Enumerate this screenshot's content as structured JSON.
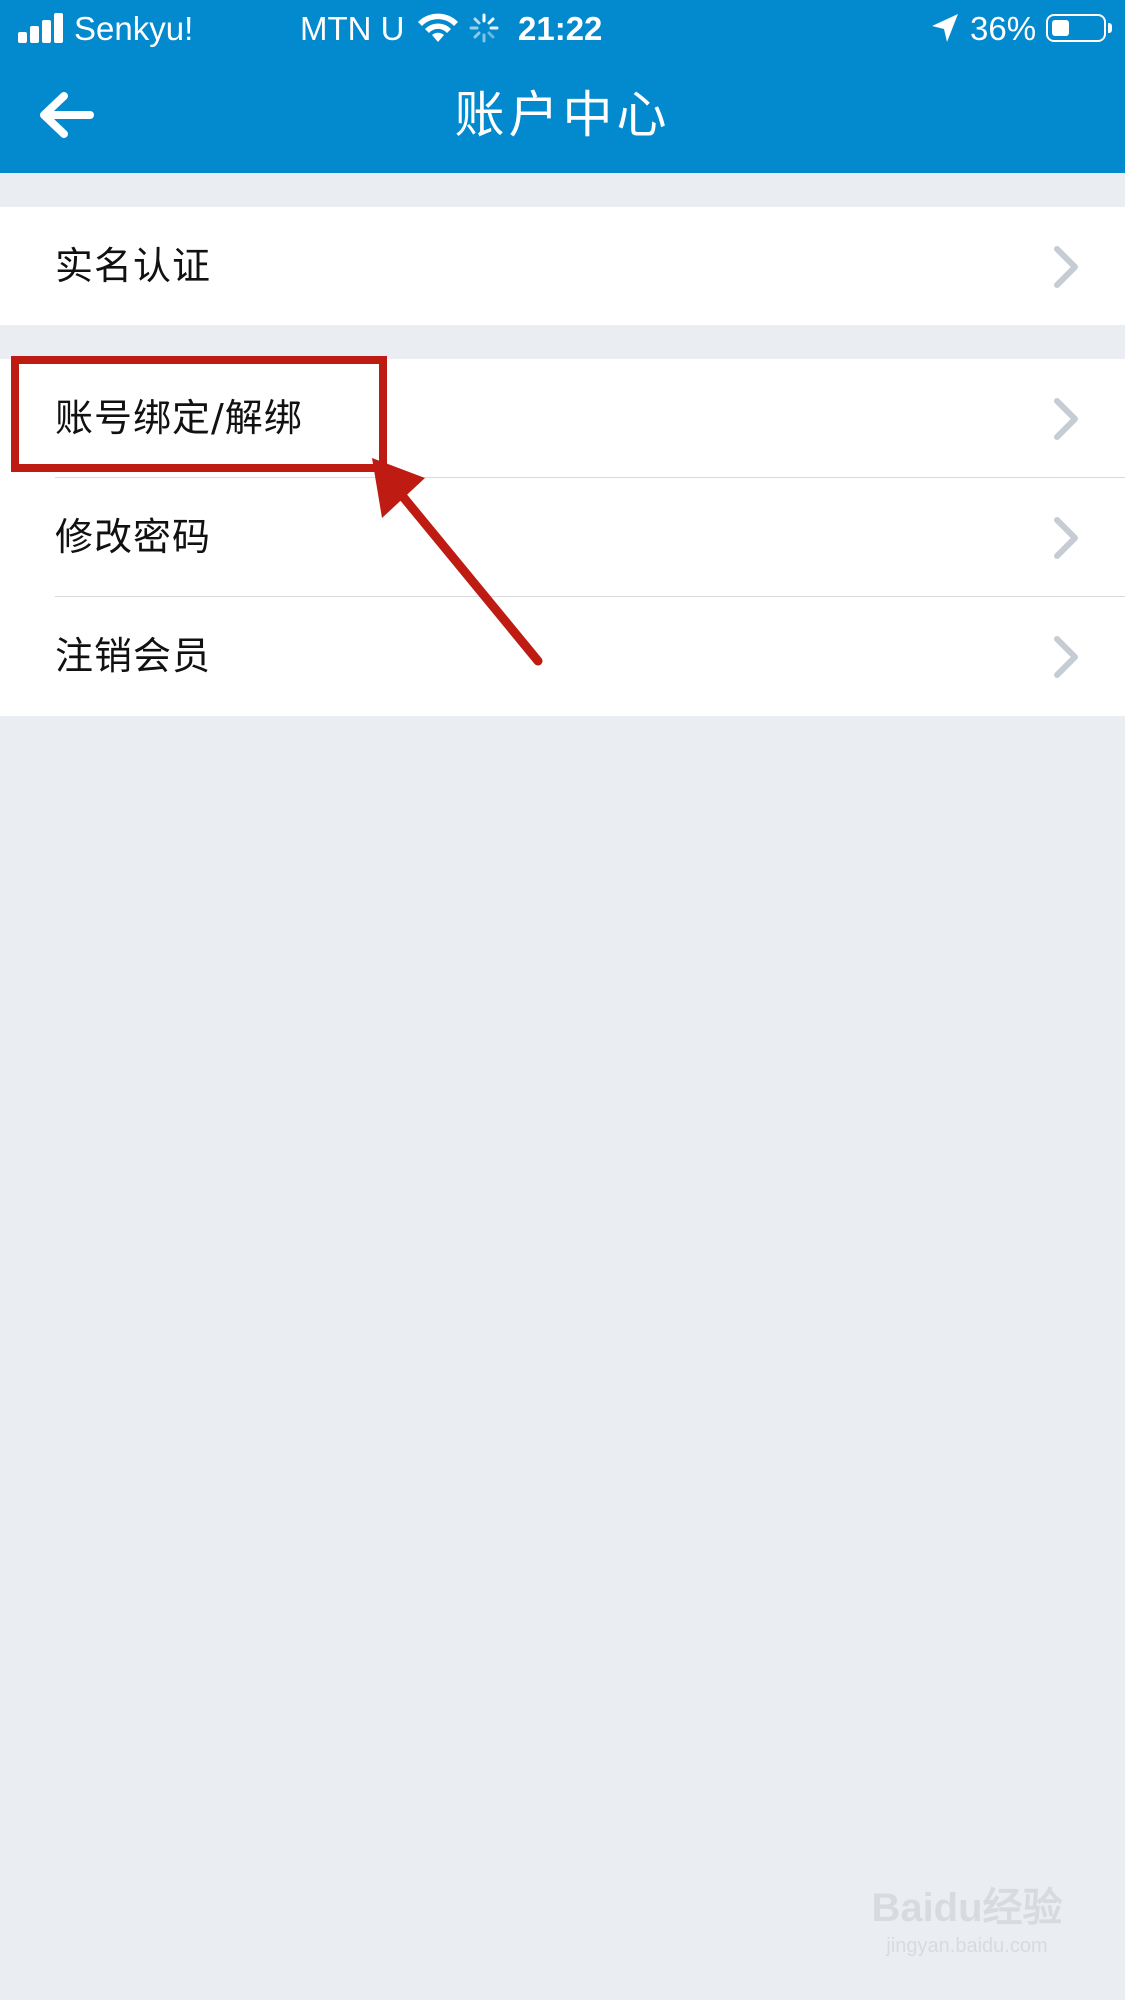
{
  "status_bar": {
    "carrier_1": "Senkyu!",
    "carrier_2": "MTN U",
    "time": "21:22",
    "battery_percent": "36%",
    "battery_level": 0.36,
    "icons": [
      "signal-icon",
      "wifi-icon",
      "loading-icon",
      "location-icon",
      "battery-icon"
    ]
  },
  "nav": {
    "title": "账户中心",
    "back_icon": "arrow-left-icon"
  },
  "menu_groups": [
    {
      "items": [
        {
          "label": "实名认证"
        }
      ]
    },
    {
      "items": [
        {
          "label": "账号绑定/解绑"
        },
        {
          "label": "修改密码"
        },
        {
          "label": "注销会员"
        }
      ]
    }
  ],
  "annotation": {
    "highlighted_item": "账号绑定/解绑",
    "color": "#be1b12"
  },
  "watermark": {
    "main": "Baidu经验",
    "sub": "jingyan.baidu.com"
  },
  "colors": {
    "header": "#0389cd",
    "background": "#eaeef2",
    "row": "#ffffff",
    "chevron": "#c5ccd4"
  }
}
